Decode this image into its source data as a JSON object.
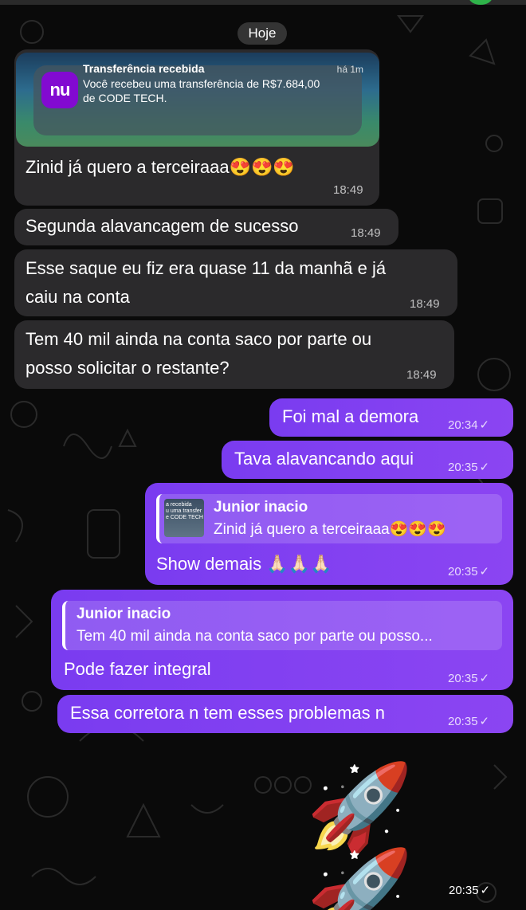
{
  "date_separator": "Hoje",
  "messages": [
    {
      "direction": "incoming",
      "screenshot": {
        "app_logo": "nu",
        "title": "Transferência recebida",
        "ago": "há 1m",
        "body": "Você recebeu uma transferência de R$7.684,00 de CODE TECH."
      },
      "text": "Zinid já quero a terceiraaa😍😍😍",
      "time": "18:49"
    },
    {
      "direction": "incoming",
      "text": "Segunda alavancagem de sucesso",
      "time": "18:49"
    },
    {
      "direction": "incoming",
      "text_lines": [
        "Esse saque eu fiz era quase 11 da manhã e já",
        "caiu na conta"
      ],
      "time": "18:49"
    },
    {
      "direction": "incoming",
      "text_lines": [
        "Tem 40 mil ainda na conta saco por parte ou",
        "posso solicitar o restante?"
      ],
      "time": "18:49"
    },
    {
      "direction": "outgoing",
      "text": "Foi mal a demora",
      "time": "20:34",
      "status": "✓"
    },
    {
      "direction": "outgoing",
      "text": "Tava alavancando aqui",
      "time": "20:35",
      "status": "✓"
    },
    {
      "direction": "outgoing",
      "reply": {
        "author": "Junior inacio",
        "thumb_text": "a recebida\nu uma transfer\ne CODE TECH",
        "quote": "Zinid já quero a terceiraaa😍😍😍"
      },
      "text": "Show demais 🙏🏻🙏🏻🙏🏻",
      "time": "20:35",
      "status": "✓"
    },
    {
      "direction": "outgoing",
      "reply": {
        "author": "Junior inacio",
        "quote": "Tem 40 mil ainda na conta saco por parte ou posso..."
      },
      "text": "Pode fazer integral",
      "time": "20:35",
      "status": "✓"
    },
    {
      "direction": "outgoing",
      "text": "Essa corretora n tem esses problemas n",
      "time": "20:35",
      "status": "✓"
    },
    {
      "direction": "outgoing",
      "emoji": "🚀🚀",
      "time": "20:35",
      "status": "✓"
    }
  ],
  "colors": {
    "incoming_bubble": "#2b2a2c",
    "outgoing_bubble": "#7c3aed",
    "nubank_purple": "#820ad1"
  }
}
